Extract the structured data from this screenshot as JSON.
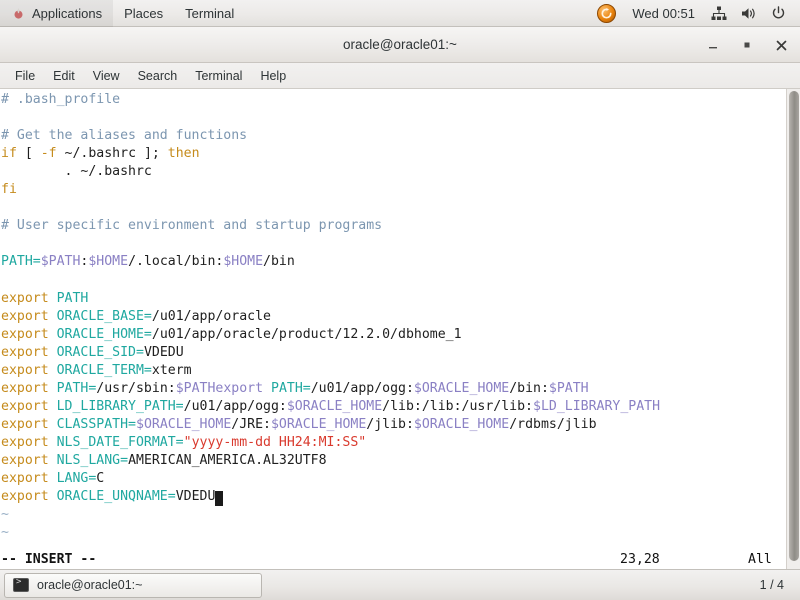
{
  "top_panel": {
    "apps_icon": "fedora-logo-icon",
    "menus": [
      "Applications",
      "Places",
      "Terminal"
    ],
    "updates_icon": "software-update-icon",
    "clock": "Wed 00:51",
    "tray": [
      "network-icon",
      "volume-icon",
      "power-icon"
    ]
  },
  "window": {
    "title": "oracle@oracle01:~",
    "buttons": {
      "minimize": "–",
      "maximize": "■",
      "close": "✕"
    },
    "menubar": [
      "File",
      "Edit",
      "View",
      "Search",
      "Terminal",
      "Help"
    ]
  },
  "terminal": {
    "lines": [
      [
        {
          "t": "# .bash_profile",
          "c": "c-comment"
        }
      ],
      [],
      [
        {
          "t": "# Get the aliases and functions",
          "c": "c-comment"
        }
      ],
      [
        {
          "t": "if",
          "c": "c-keyword"
        },
        {
          "t": " [ ",
          "c": "c-plain"
        },
        {
          "t": "-f",
          "c": "c-keyword"
        },
        {
          "t": " ~/.bashrc ]; ",
          "c": "c-plain"
        },
        {
          "t": "then",
          "c": "c-keyword"
        }
      ],
      [
        {
          "t": "        . ~/.bashrc",
          "c": "c-plain"
        }
      ],
      [
        {
          "t": "fi",
          "c": "c-keyword"
        }
      ],
      [],
      [
        {
          "t": "# User specific environment and startup programs",
          "c": "c-comment"
        }
      ],
      [],
      [
        {
          "t": "PATH=",
          "c": "c-ident"
        },
        {
          "t": "$PATH",
          "c": "c-var"
        },
        {
          "t": ":",
          "c": "c-plain"
        },
        {
          "t": "$HOME",
          "c": "c-var"
        },
        {
          "t": "/.local/bin:",
          "c": "c-plain"
        },
        {
          "t": "$HOME",
          "c": "c-var"
        },
        {
          "t": "/bin",
          "c": "c-plain"
        }
      ],
      [],
      [
        {
          "t": "export",
          "c": "c-keyword"
        },
        {
          "t": " ",
          "c": "c-plain"
        },
        {
          "t": "PATH",
          "c": "c-ident"
        }
      ],
      [
        {
          "t": "export",
          "c": "c-keyword"
        },
        {
          "t": " ",
          "c": "c-plain"
        },
        {
          "t": "ORACLE_BASE=",
          "c": "c-ident"
        },
        {
          "t": "/u01/app/oracle",
          "c": "c-plain"
        }
      ],
      [
        {
          "t": "export",
          "c": "c-keyword"
        },
        {
          "t": " ",
          "c": "c-plain"
        },
        {
          "t": "ORACLE_HOME=",
          "c": "c-ident"
        },
        {
          "t": "/u01/app/oracle/product/12.2.0/dbhome_1",
          "c": "c-plain"
        }
      ],
      [
        {
          "t": "export",
          "c": "c-keyword"
        },
        {
          "t": " ",
          "c": "c-plain"
        },
        {
          "t": "ORACLE_SID=",
          "c": "c-ident"
        },
        {
          "t": "VDEDU",
          "c": "c-plain"
        }
      ],
      [
        {
          "t": "export",
          "c": "c-keyword"
        },
        {
          "t": " ",
          "c": "c-plain"
        },
        {
          "t": "ORACLE_TERM=",
          "c": "c-ident"
        },
        {
          "t": "xterm",
          "c": "c-plain"
        }
      ],
      [
        {
          "t": "export",
          "c": "c-keyword"
        },
        {
          "t": " ",
          "c": "c-plain"
        },
        {
          "t": "PATH=",
          "c": "c-ident"
        },
        {
          "t": "/usr/sbin:",
          "c": "c-plain"
        },
        {
          "t": "$PATHexport",
          "c": "c-var"
        },
        {
          "t": " ",
          "c": "c-plain"
        },
        {
          "t": "PATH=",
          "c": "c-ident"
        },
        {
          "t": "/u01/app/ogg:",
          "c": "c-plain"
        },
        {
          "t": "$ORACLE_HOME",
          "c": "c-var"
        },
        {
          "t": "/bin:",
          "c": "c-plain"
        },
        {
          "t": "$PATH",
          "c": "c-var"
        }
      ],
      [
        {
          "t": "export",
          "c": "c-keyword"
        },
        {
          "t": " ",
          "c": "c-plain"
        },
        {
          "t": "LD_LIBRARY_PATH=",
          "c": "c-ident"
        },
        {
          "t": "/u01/app/ogg:",
          "c": "c-plain"
        },
        {
          "t": "$ORACLE_HOME",
          "c": "c-var"
        },
        {
          "t": "/lib:/lib:/usr/lib:",
          "c": "c-plain"
        },
        {
          "t": "$LD_LIBRARY_PATH",
          "c": "c-var"
        }
      ],
      [
        {
          "t": "export",
          "c": "c-keyword"
        },
        {
          "t": " ",
          "c": "c-plain"
        },
        {
          "t": "CLASSPATH=",
          "c": "c-ident"
        },
        {
          "t": "$ORACLE_HOME",
          "c": "c-var"
        },
        {
          "t": "/JRE:",
          "c": "c-plain"
        },
        {
          "t": "$ORACLE_HOME",
          "c": "c-var"
        },
        {
          "t": "/jlib:",
          "c": "c-plain"
        },
        {
          "t": "$ORACLE_HOME",
          "c": "c-var"
        },
        {
          "t": "/rdbms/jlib",
          "c": "c-plain"
        }
      ],
      [
        {
          "t": "export",
          "c": "c-keyword"
        },
        {
          "t": " ",
          "c": "c-plain"
        },
        {
          "t": "NLS_DATE_FORMAT=",
          "c": "c-ident"
        },
        {
          "t": "\"yyyy-mm-dd HH24:MI:SS\"",
          "c": "c-string"
        }
      ],
      [
        {
          "t": "export",
          "c": "c-keyword"
        },
        {
          "t": " ",
          "c": "c-plain"
        },
        {
          "t": "NLS_LANG=",
          "c": "c-ident"
        },
        {
          "t": "AMERICAN_AMERICA.AL32UTF8",
          "c": "c-plain"
        }
      ],
      [
        {
          "t": "export",
          "c": "c-keyword"
        },
        {
          "t": " ",
          "c": "c-plain"
        },
        {
          "t": "LANG=",
          "c": "c-ident"
        },
        {
          "t": "C",
          "c": "c-plain"
        }
      ],
      [
        {
          "t": "export",
          "c": "c-keyword"
        },
        {
          "t": " ",
          "c": "c-plain"
        },
        {
          "t": "ORACLE_UNQNAME=",
          "c": "c-ident"
        },
        {
          "t": "VDEDU",
          "c": "c-plain"
        },
        {
          "t": "CURSOR",
          "c": "cursor"
        }
      ],
      [
        {
          "t": "~",
          "c": "c-tilde"
        }
      ],
      [
        {
          "t": "~",
          "c": "c-tilde"
        }
      ]
    ],
    "status": {
      "mode": "-- INSERT --",
      "position": "23,28",
      "scroll": "All"
    }
  },
  "taskbar": {
    "window_button": {
      "icon": "terminal-icon",
      "label": "oracle@oracle01:~"
    },
    "workspace": "1 / 4"
  }
}
